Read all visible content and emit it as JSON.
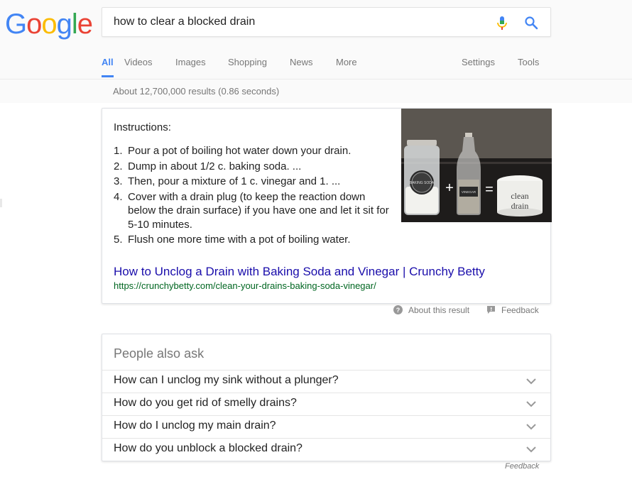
{
  "logo": {
    "letters": [
      "G",
      "o",
      "o",
      "g",
      "l",
      "e"
    ],
    "colors": [
      "#4285f4",
      "#ea4335",
      "#fbbc05",
      "#4285f4",
      "#34a853",
      "#ea4335"
    ]
  },
  "search": {
    "query": "how to clear a blocked drain",
    "mic_icon": "mic-icon",
    "search_icon": "search-icon"
  },
  "tabs": {
    "all": "All",
    "videos": "Videos",
    "images": "Images",
    "shopping": "Shopping",
    "news": "News",
    "more": "More",
    "settings": "Settings",
    "tools": "Tools"
  },
  "results": {
    "count_text": "About 12,700,000 results (0.86 seconds)"
  },
  "featured": {
    "instructions_title": "Instructions:",
    "steps": [
      {
        "num": "1.",
        "text": "Pour a pot of boiling hot water down your drain."
      },
      {
        "num": "2.",
        "text": "Dump in about 1/2 c. baking soda. ..."
      },
      {
        "num": "3.",
        "text": "Then, pour a mixture of 1 c. vinegar and 1. ..."
      },
      {
        "num": "4.",
        "text": "Cover with a drain plug (to keep the reaction down below the drain surface) if you have one and let it sit for 5-10 minutes."
      },
      {
        "num": "5.",
        "text": "Flush one more time with a pot of boiling water."
      }
    ],
    "image_labels": {
      "jar": "BAKING SODA",
      "bottle": "VINEGAR",
      "plus": "+",
      "equals": "=",
      "bowl_line1": "clean",
      "bowl_line2": "drain"
    },
    "link_title": "How to Unclog a Drain with Baking Soda and Vinegar | Crunchy Betty",
    "link_url": "https://crunchybetty.com/clean-your-drains-baking-soda-vinegar/"
  },
  "meta": {
    "about": "About this result",
    "feedback": "Feedback"
  },
  "paa": {
    "title": "People also ask",
    "questions": [
      "How can I unclog my sink without a plunger?",
      "How do you get rid of smelly drains?",
      "How do I unclog my main drain?",
      "How do you unblock a blocked drain?"
    ],
    "feedback": "Feedback"
  }
}
